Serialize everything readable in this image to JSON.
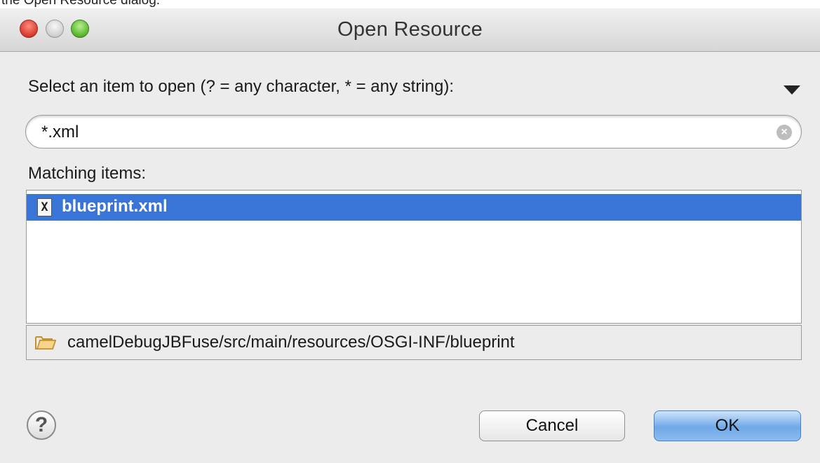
{
  "window": {
    "top_fragment": "the Open Resource dialog.",
    "title": "Open Resource"
  },
  "dialog": {
    "prompt_label": "Select an item to open (? = any character, * = any string):",
    "search_value": "*.xml",
    "matching_label": "Matching items:",
    "items": [
      {
        "label": "blueprint.xml",
        "icon": "xml-file-icon",
        "selected": true
      }
    ],
    "location_path": "camelDebugJBFuse/src/main/resources/OSGI-INF/blueprint",
    "clear_glyph": "×"
  },
  "buttons": {
    "help": "?",
    "cancel": "Cancel",
    "ok": "OK"
  },
  "colors": {
    "selection": "#3875d7",
    "window_bg": "#ececec",
    "close_red": "#d83a2e",
    "zoom_green": "#57b52d"
  }
}
